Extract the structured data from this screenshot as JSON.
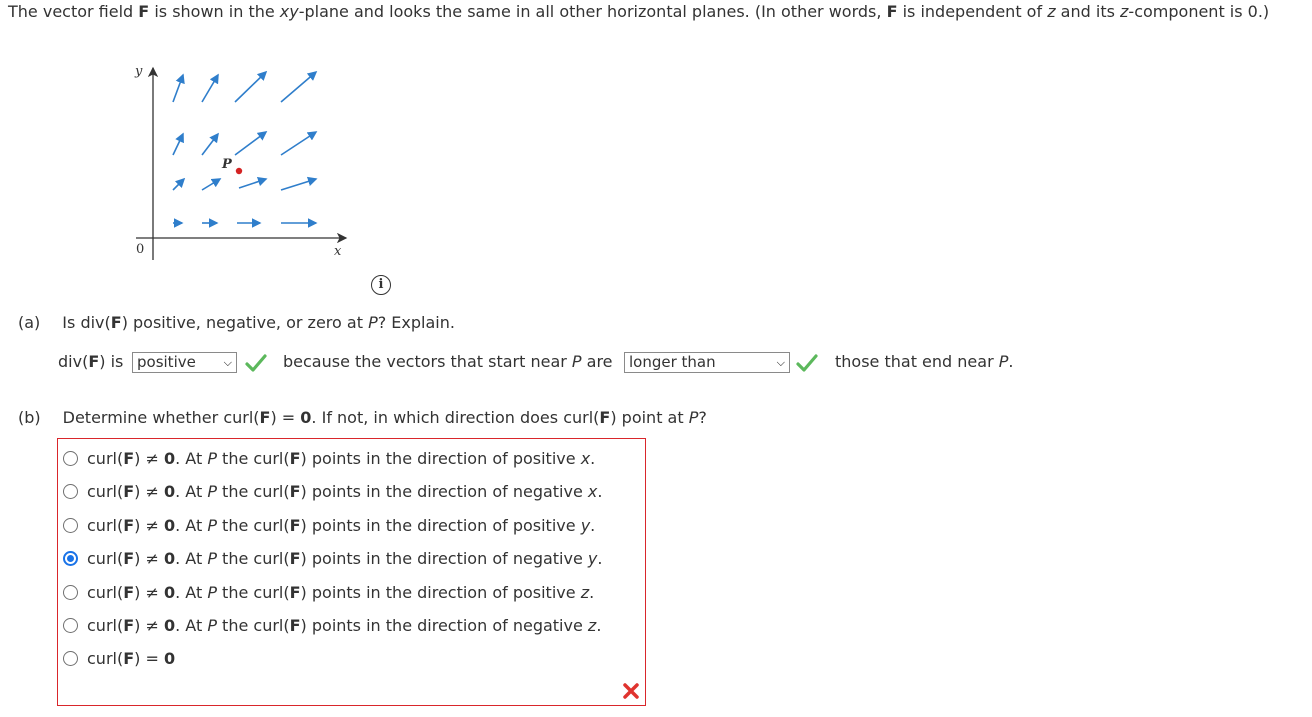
{
  "intro": {
    "part1": "The vector field ",
    "F": "F",
    "part2": " is shown in the ",
    "xy": "xy",
    "part3": "-plane and looks the same in all other horizontal planes. (In other words, ",
    "F2": "F",
    "part4": " is independent of ",
    "z1": "z",
    "part5": " and its ",
    "z2": "z",
    "part6": "-component is 0.)"
  },
  "figure": {
    "y_label": "y",
    "x_label": "x",
    "origin_label": "0",
    "point_label": "P",
    "arrow_color": "#2f7ecb",
    "point_color": "#d42323"
  },
  "info_icon": "i",
  "part_a": {
    "label": "(a)",
    "question_pre": "Is div(",
    "F": "F",
    "question_mid": ") positive, negative, or zero at ",
    "P": "P",
    "question_post": "? Explain.",
    "div_pre": "div(",
    "div_F": "F",
    "div_post": ") is",
    "select1_value": "positive",
    "because_pre": "because the vectors that start near ",
    "because_P": "P",
    "because_post": " are",
    "select2_value": "longer than",
    "those_pre": "those that end near ",
    "those_P": "P",
    "those_post": "."
  },
  "part_b": {
    "label": "(b)",
    "q_pre": "Determine whether curl(",
    "q_F": "F",
    "q_mid1": ") = ",
    "q_zero": "0",
    "q_mid2": ". If not, in which direction does curl(",
    "q_F2": "F",
    "q_mid3": ") point at ",
    "q_P": "P",
    "q_post": "?",
    "options": [
      {
        "dir": "positive",
        "axis": "x",
        "selected": false
      },
      {
        "dir": "negative",
        "axis": "x",
        "selected": false
      },
      {
        "dir": "positive",
        "axis": "y",
        "selected": false
      },
      {
        "dir": "negative",
        "axis": "y",
        "selected": true
      },
      {
        "dir": "positive",
        "axis": "z",
        "selected": false
      },
      {
        "dir": "negative",
        "axis": "z",
        "selected": false
      }
    ],
    "opt_curl": "curl(",
    "opt_F": "F",
    "opt_neq": ") ≠ ",
    "opt_zero": "0",
    "opt_at": ". At ",
    "opt_P": "P",
    "opt_mid": " the curl(",
    "opt_F2": "F",
    "opt_points": ") points in the direction of ",
    "last_pre": "curl(",
    "last_F": "F",
    "last_eq": ") = ",
    "last_zero": "0",
    "status_colors": {
      "check": "#5cb85c",
      "error": "#e0332f",
      "border": "#d9262b",
      "radio": "#1a73e8"
    }
  }
}
